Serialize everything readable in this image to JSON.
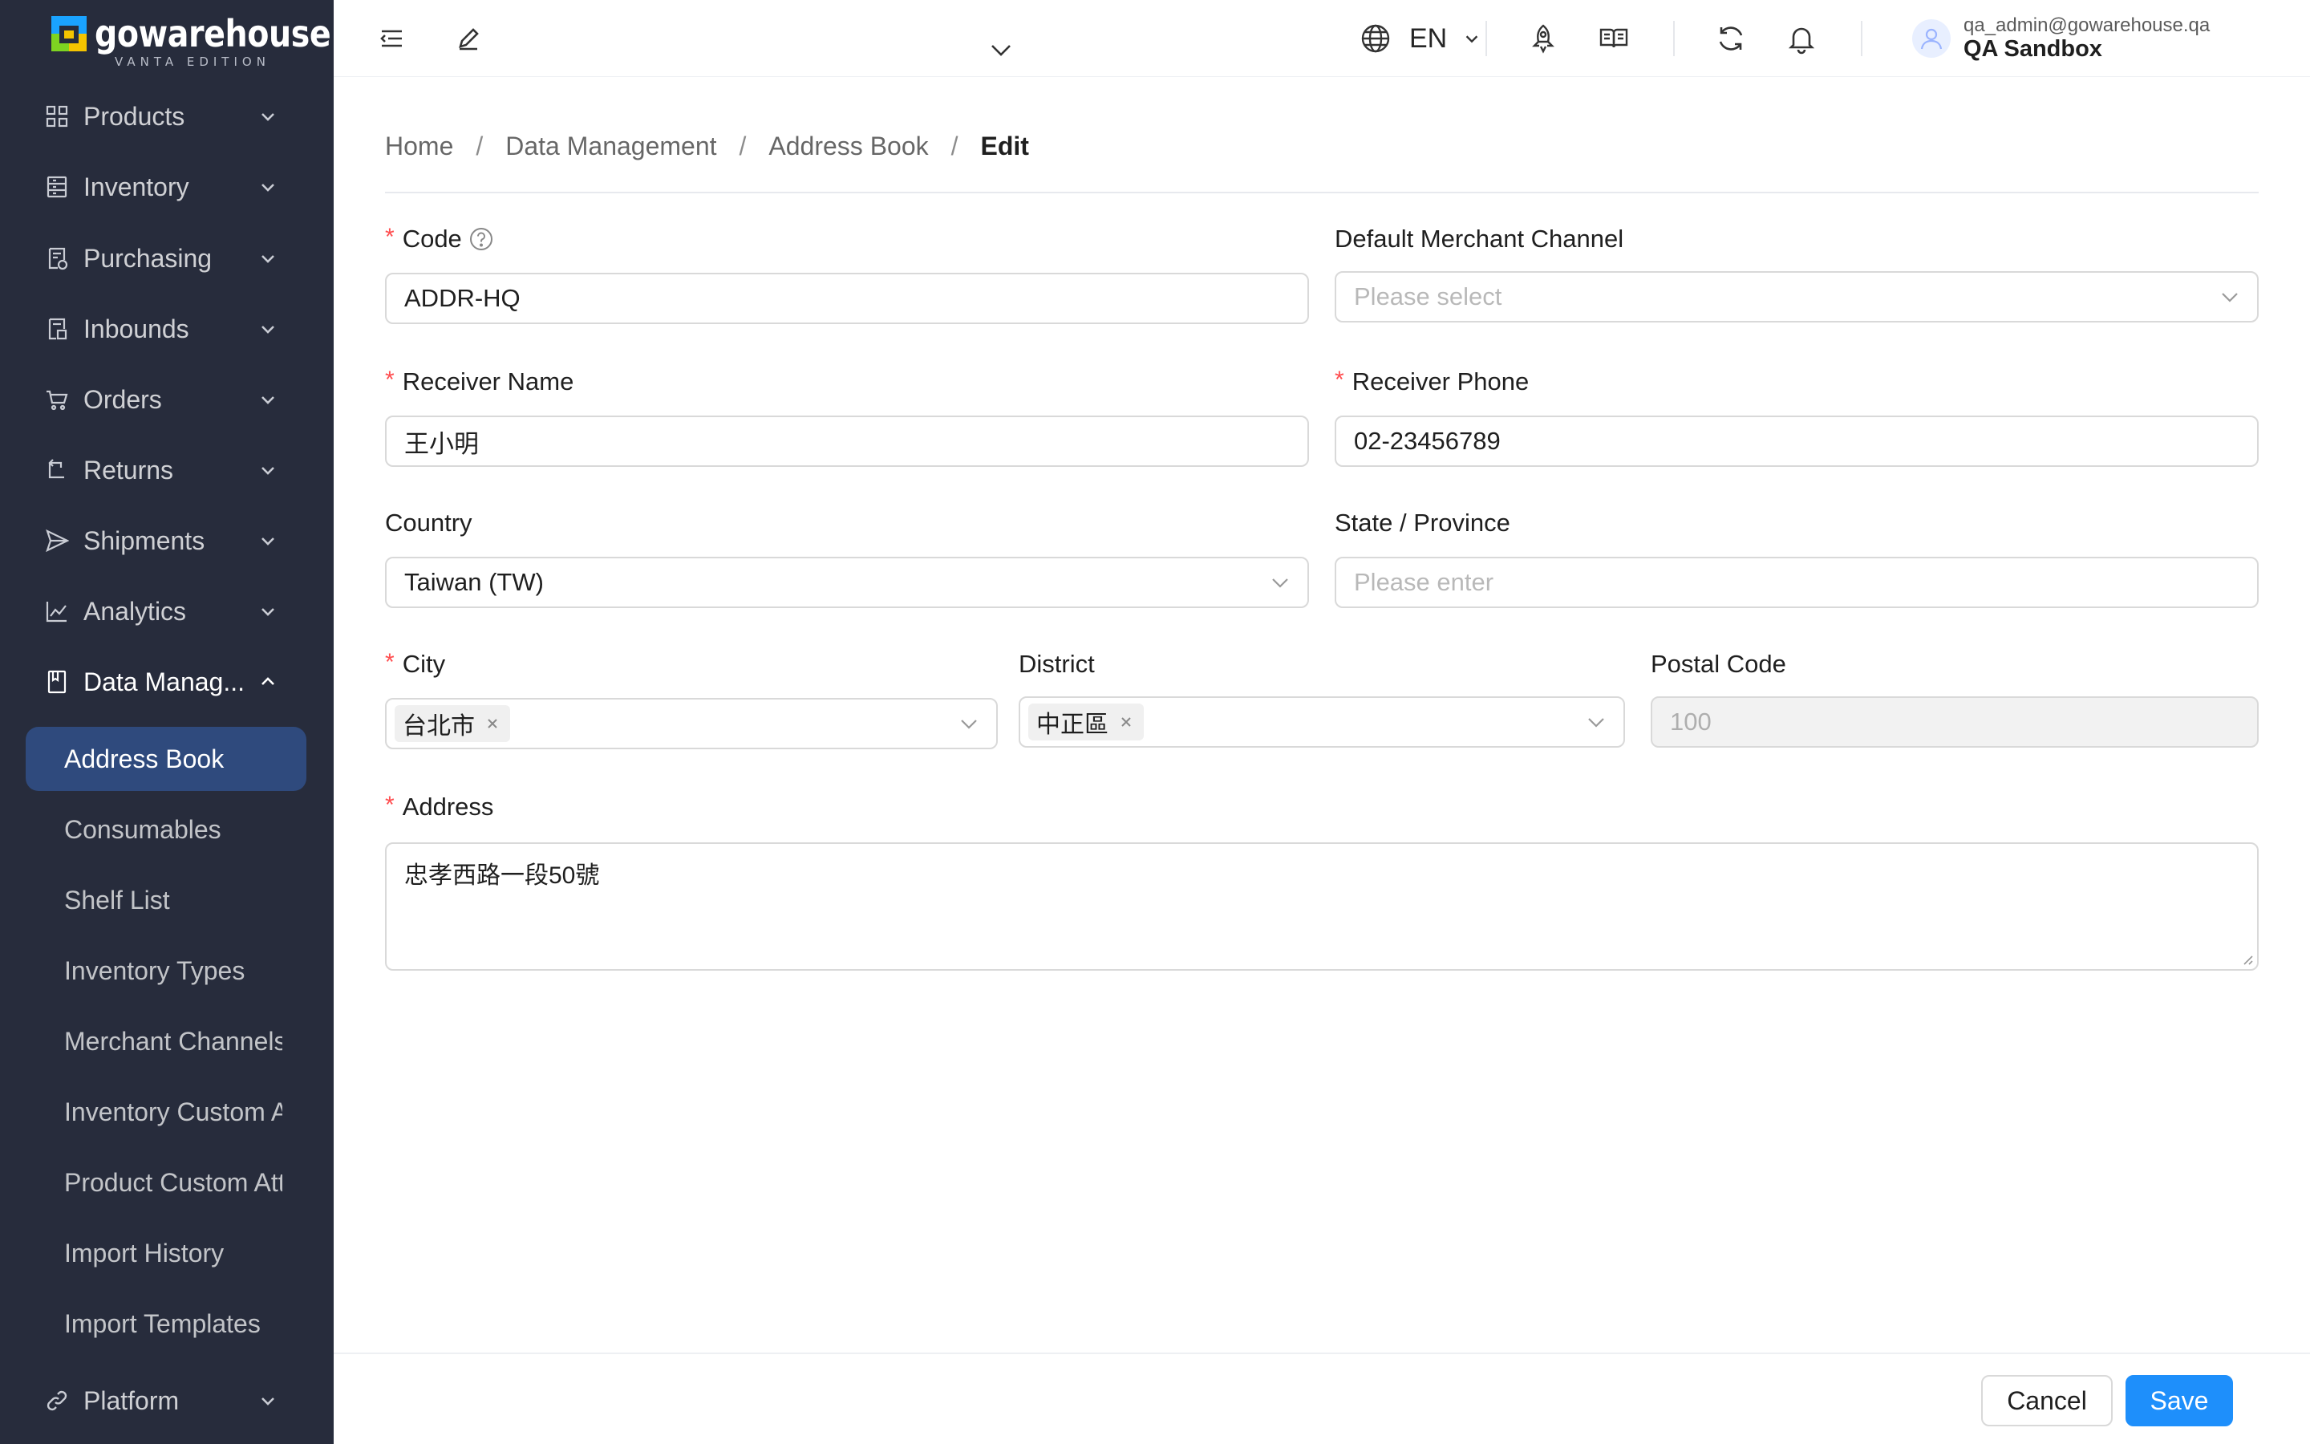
{
  "brand": {
    "name": "gowarehouse",
    "edition": "VANTA EDITION",
    "colors": {
      "sidebar_bg": "#272c3c",
      "active_item": "#2f4a7d",
      "primary": "#1e8ffb",
      "required": "#ff4d4f"
    }
  },
  "sidebar": {
    "items": [
      {
        "label": "Products",
        "icon": "grid-icon"
      },
      {
        "label": "Inventory",
        "icon": "inventory-icon"
      },
      {
        "label": "Purchasing",
        "icon": "purchasing-icon"
      },
      {
        "label": "Inbounds",
        "icon": "inbounds-icon"
      },
      {
        "label": "Orders",
        "icon": "cart-icon"
      },
      {
        "label": "Returns",
        "icon": "return-icon"
      },
      {
        "label": "Shipments",
        "icon": "send-icon"
      },
      {
        "label": "Analytics",
        "icon": "line-chart-icon"
      },
      {
        "label": "Data Manag...",
        "icon": "book-icon"
      }
    ],
    "sub_items": [
      {
        "label": "Address Book"
      },
      {
        "label": "Consumables"
      },
      {
        "label": "Shelf List"
      },
      {
        "label": "Inventory Types"
      },
      {
        "label": "Merchant Channels"
      },
      {
        "label": "Inventory Custom Attributes"
      },
      {
        "label": "Product Custom Attributes"
      },
      {
        "label": "Import History"
      },
      {
        "label": "Import Templates"
      }
    ],
    "platform": {
      "label": "Platform",
      "icon": "link-icon"
    }
  },
  "header": {
    "language": "EN",
    "user_email": "qa_admin@gowarehouse.qa",
    "user_org": "QA Sandbox"
  },
  "breadcrumb": {
    "home": "Home",
    "section": "Data Management",
    "page": "Address Book",
    "current": "Edit",
    "separator": "/"
  },
  "form": {
    "required_mark": "*",
    "code": {
      "label": "Code",
      "value": "ADDR-HQ"
    },
    "merchant_channel": {
      "label": "Default Merchant Channel",
      "placeholder": "Please select"
    },
    "receiver_name": {
      "label": "Receiver Name",
      "value": "王小明"
    },
    "receiver_phone": {
      "label": "Receiver Phone",
      "value": "02-23456789"
    },
    "country": {
      "label": "Country",
      "value": "Taiwan (TW)"
    },
    "state": {
      "label": "State / Province",
      "placeholder": "Please enter"
    },
    "city": {
      "label": "City",
      "tag": "台北市"
    },
    "district": {
      "label": "District",
      "tag": "中正區"
    },
    "postal_code": {
      "label": "Postal Code",
      "value": "100"
    },
    "address": {
      "label": "Address",
      "value": "忠孝西路一段50號"
    }
  },
  "footer": {
    "cancel_label": "Cancel",
    "save_label": "Save"
  }
}
